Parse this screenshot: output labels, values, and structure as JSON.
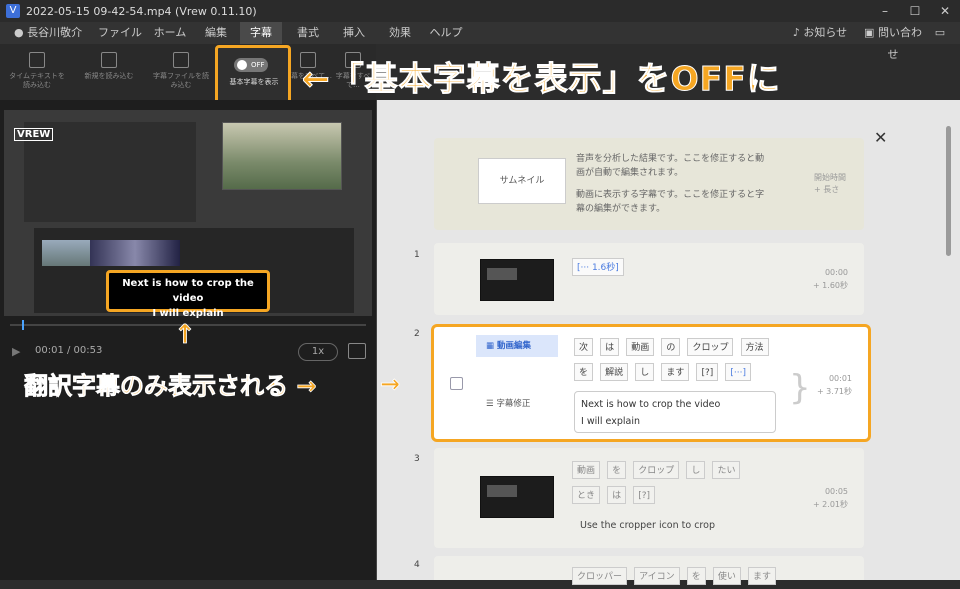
{
  "window": {
    "title": "2022-05-15 09-42-54.mp4 (Vrew 0.11.10)",
    "app_icon": "V",
    "minimize": "–",
    "maximize": "☐",
    "close": "✕"
  },
  "menu": {
    "user": "長谷川敬介",
    "items": [
      "ファイル",
      "ホーム",
      "編集",
      "字幕",
      "書式",
      "挿入",
      "効果",
      "ヘルプ"
    ],
    "active": "字幕",
    "notifications": "お知らせ",
    "contact": "問い合わせ"
  },
  "toolbar": {
    "items": [
      {
        "label": "タイムテキストを読み込む"
      },
      {
        "label": "新規を読み込む"
      },
      {
        "label": "字幕ファイルを読み込む"
      },
      {
        "label": "基本字幕を表示",
        "toggle": "OFF"
      },
      {
        "label": "字幕をすべて..."
      },
      {
        "label": "字幕をすべて..."
      }
    ]
  },
  "annotations": {
    "top": "←「基本字幕を表示」をOFFに",
    "left": "翻訳字幕のみ表示される →",
    "up_arrow": "↑"
  },
  "player": {
    "logo": "VREW",
    "subtitle_line1": "Next is how to crop the video",
    "subtitle_line2": "I will explain",
    "time": "00:01 / 00:53",
    "speed": "1x"
  },
  "header_card": {
    "thumbnail_label": "サムネイル",
    "text1": "音声を分析した結果です。ここを修正すると動画が自動で編集されます。",
    "text2": "動画に表示する字幕です。ここを修正すると字幕の編集ができます。",
    "meta1": "開始時間",
    "meta2": "+ 長さ"
  },
  "rows": [
    {
      "num": "1",
      "words": [
        "[··· 1.6秒]"
      ],
      "start": "00:00",
      "length": "+ 1.60秒"
    },
    {
      "num": "2",
      "tag_edit": "動画編集",
      "tag_fix": "字幕修正",
      "words": [
        "次",
        "は",
        "動画",
        "の",
        "クロップ",
        "方法",
        "を",
        "解説",
        "し",
        "ます",
        "[?]",
        "[···]"
      ],
      "subtitle_line1": "Next is how to crop the video",
      "subtitle_line2": "I will explain",
      "start": "00:01",
      "length": "+ 3.71秒"
    },
    {
      "num": "3",
      "words": [
        "動画",
        "を",
        "クロップ",
        "し",
        "たい",
        "とき",
        "は",
        "[?]"
      ],
      "subtitle": "Use the cropper icon to crop",
      "start": "00:05",
      "length": "+ 2.01秒"
    },
    {
      "num": "4",
      "words": [
        "クロッパー",
        "アイコン",
        "を",
        "使い",
        "ます"
      ]
    }
  ]
}
